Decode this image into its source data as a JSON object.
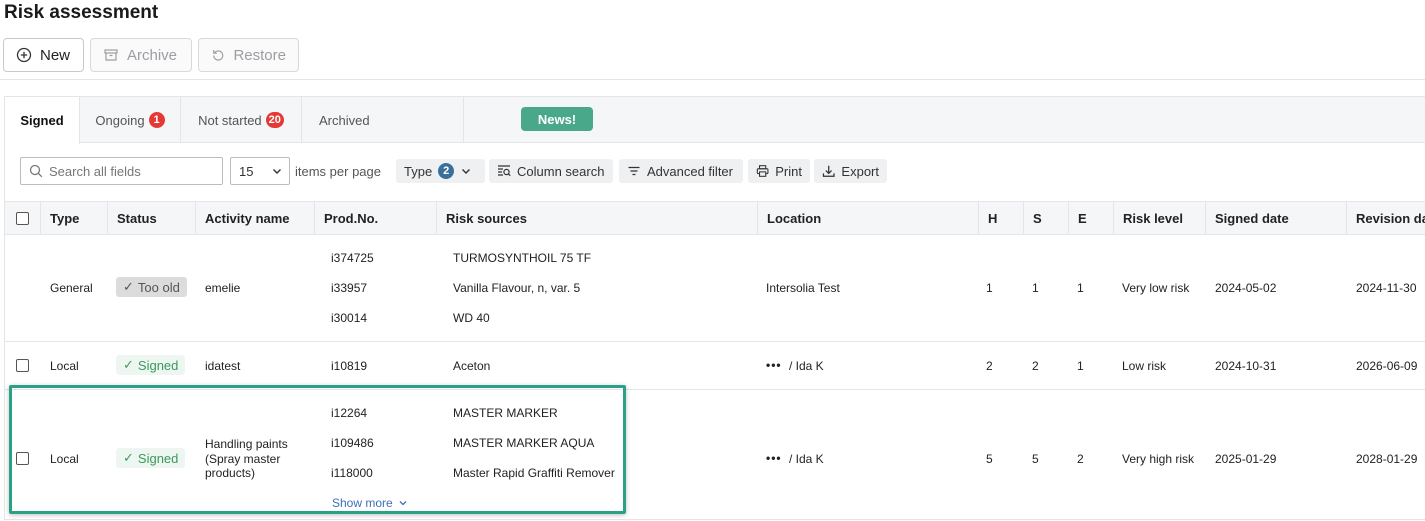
{
  "page": {
    "title": "Risk assessment"
  },
  "toolbar": {
    "new_label": "New",
    "archive_label": "Archive",
    "restore_label": "Restore"
  },
  "tabs": [
    {
      "label": "Signed",
      "count": ""
    },
    {
      "label": "Ongoing",
      "count": "1"
    },
    {
      "label": "Not started",
      "count": "20"
    },
    {
      "label": "Archived",
      "count": ""
    }
  ],
  "news_label": "News!",
  "filters": {
    "search_placeholder": "Search all fields",
    "per_page_value": "15",
    "per_page_label": "items per page",
    "type_label": "Type",
    "type_count": "2",
    "column_search_label": "Column search",
    "advanced_filter_label": "Advanced filter",
    "print_label": "Print",
    "export_label": "Export"
  },
  "columns": [
    "Type",
    "Status",
    "Activity name",
    "Prod.No.",
    "Risk sources",
    "Location",
    "H",
    "S",
    "E",
    "Risk level",
    "Signed date",
    "Revision dat"
  ],
  "rows": [
    {
      "type": "General",
      "status": "Too old",
      "activity": "emelie",
      "prod_nos": [
        "i374725",
        "i33957",
        "i30014"
      ],
      "sources": [
        "TURMOSYNTHOIL 75 TF",
        "Vanilla Flavour, n, var. 5",
        "WD 40"
      ],
      "location": "Intersolia Test",
      "h": "1",
      "s": "1",
      "e": "1",
      "risk_level": "Very low risk",
      "signed_date": "2024-05-02",
      "revision_date": "2024-11-30"
    },
    {
      "type": "Local",
      "status": "Signed",
      "activity": "idatest",
      "prod_nos": [
        "i10819"
      ],
      "sources": [
        "Aceton"
      ],
      "location_dots": "•••",
      "location": "/ Ida K",
      "h": "2",
      "s": "2",
      "e": "1",
      "risk_level": "Low risk",
      "signed_date": "2024-10-31",
      "revision_date": "2026-06-09"
    },
    {
      "type": "Local",
      "status": "Signed",
      "activity": "Handling paints (Spray master products)",
      "prod_nos": [
        "i12264",
        "i109486",
        "i118000"
      ],
      "sources": [
        "MASTER MARKER",
        "MASTER MARKER AQUA",
        "Master Rapid Graffiti Remover"
      ],
      "show_more": "Show more",
      "location_dots": "•••",
      "location": "/ Ida K",
      "h": "5",
      "s": "5",
      "e": "2",
      "risk_level": "Very high risk",
      "signed_date": "2025-01-29",
      "revision_date": "2028-01-29"
    }
  ]
}
